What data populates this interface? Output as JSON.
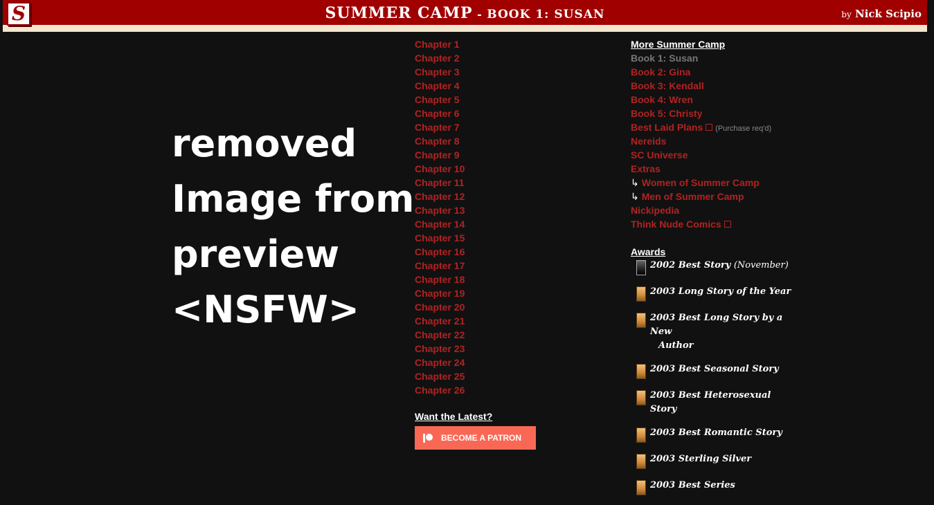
{
  "header": {
    "logo_letter": "S",
    "title_main": "SUMMER CAMP",
    "title_sep": " - ",
    "title_sub": "BOOK 1: SUSAN",
    "byline_by": "by",
    "byline_author": "Nick Scipio",
    "colors": {
      "bar": "#a00000",
      "strip": "#f3e7cf"
    }
  },
  "placeholder_text": "removed\nImage from\npreview\n<NSFW>",
  "chapters": [
    "Chapter 1",
    "Chapter 2",
    "Chapter 3",
    "Chapter 4",
    "Chapter 5",
    "Chapter 6",
    "Chapter 7",
    "Chapter 8",
    "Chapter 9",
    "Chapter 10",
    "Chapter 11",
    "Chapter 12",
    "Chapter 13",
    "Chapter 14",
    "Chapter 15",
    "Chapter 16",
    "Chapter 17",
    "Chapter 18",
    "Chapter 19",
    "Chapter 20",
    "Chapter 21",
    "Chapter 22",
    "Chapter 23",
    "Chapter 24",
    "Chapter 25",
    "Chapter 26"
  ],
  "latest": {
    "heading": "Want the Latest?",
    "patron_label": "BECOME A PATRON",
    "patron_icon": "patreon-icon",
    "patron_color": "#f96854"
  },
  "more": {
    "heading": "More Summer Camp",
    "book1": "Book 1: Susan",
    "book2": "Book 2: Gina",
    "book3": "Book 3: Kendall",
    "book4": "Book 4: Wren",
    "book5": "Book 5: Christy",
    "best_laid_plans": "Best Laid Plans",
    "purchase_note": "(Purchase req'd)",
    "nereids": "Nereids",
    "sc_universe": "SC Universe",
    "extras": "Extras",
    "sub_arrow": "↳",
    "women": "Women of Summer Camp",
    "men": "Men of Summer Camp",
    "nickipedia": "Nickipedia",
    "think_nude": "Think Nude Comics",
    "link_color": "#b22222"
  },
  "awards": {
    "heading": "Awards",
    "items": [
      {
        "title": "2002 Best Story",
        "extra": "(November)"
      },
      {
        "title": "2003 Long Story of the Year"
      },
      {
        "title": "2003 Best Long Story by a New",
        "cont": "Author"
      },
      {
        "title": "2003 Best Seasonal Story"
      },
      {
        "title": "2003 Best Heterosexual Story"
      },
      {
        "title": "2003 Best Romantic Story"
      },
      {
        "title": "2003 Sterling Silver"
      },
      {
        "title": "2003 Best Series"
      }
    ]
  }
}
